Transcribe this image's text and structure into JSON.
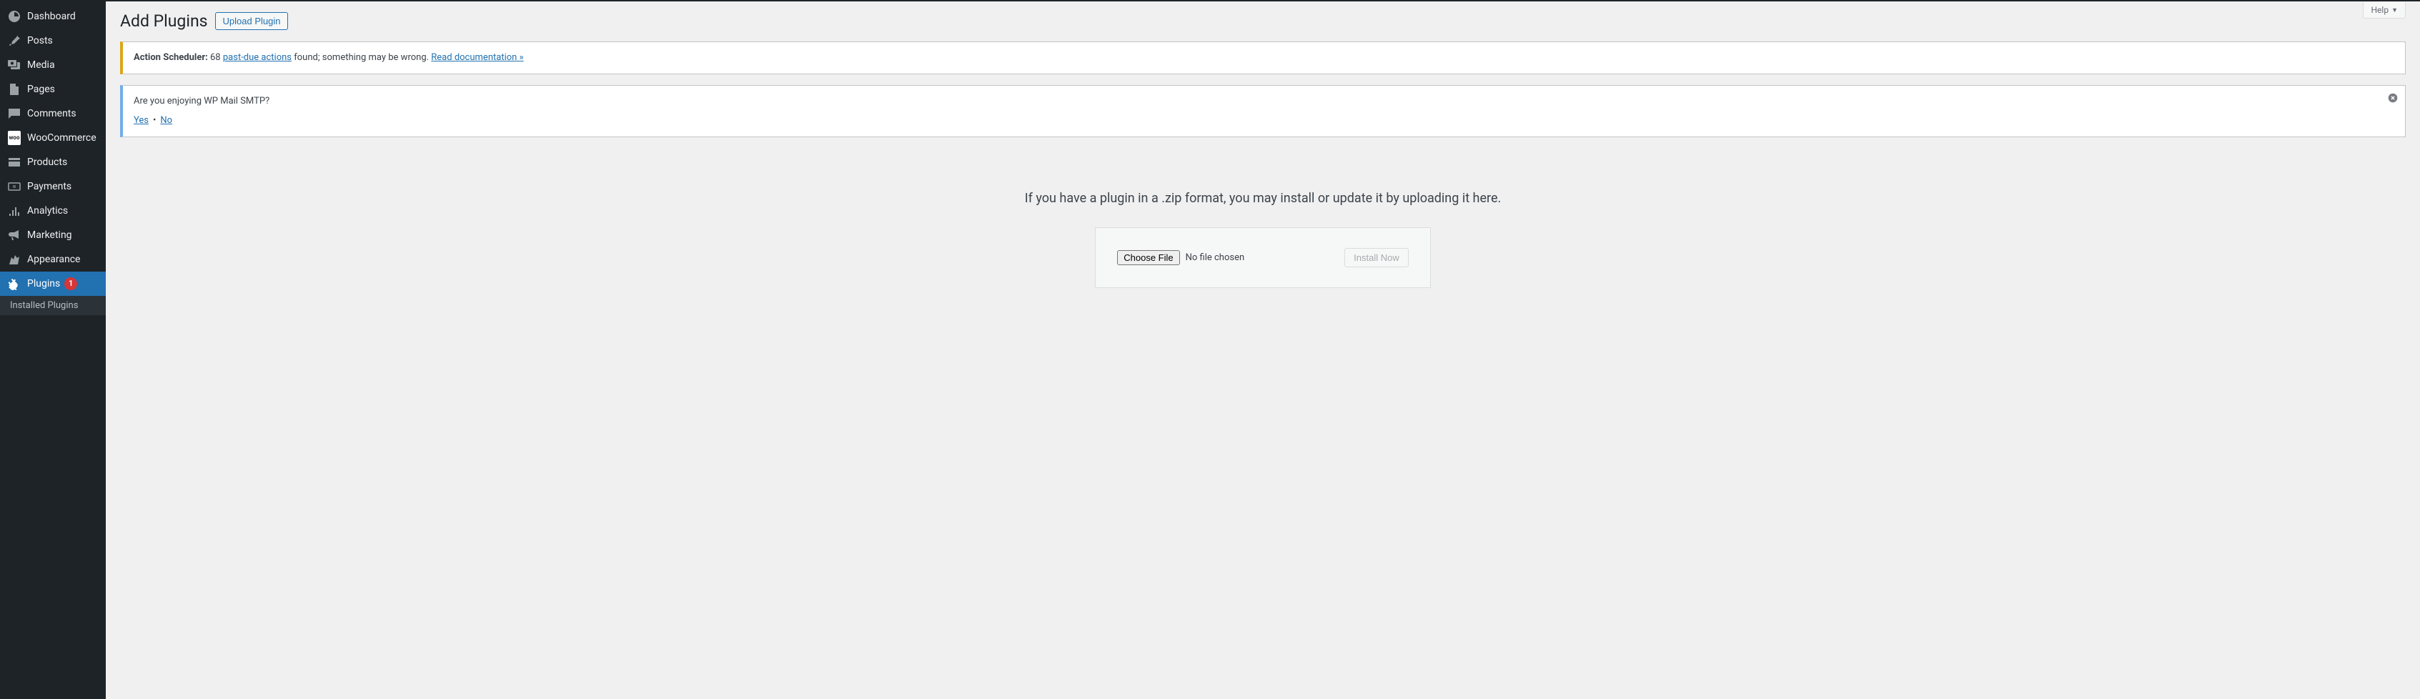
{
  "sidebar": {
    "items": [
      {
        "label": "Dashboard"
      },
      {
        "label": "Posts"
      },
      {
        "label": "Media"
      },
      {
        "label": "Pages"
      },
      {
        "label": "Comments"
      },
      {
        "label": "WooCommerce"
      },
      {
        "label": "Products"
      },
      {
        "label": "Payments"
      },
      {
        "label": "Analytics"
      },
      {
        "label": "Marketing"
      },
      {
        "label": "Appearance"
      },
      {
        "label": "Plugins",
        "badge": "1"
      }
    ],
    "submenu": {
      "installed": "Installed Plugins"
    }
  },
  "help_label": "Help",
  "page": {
    "title": "Add Plugins",
    "upload_btn": "Upload Plugin"
  },
  "notice_as": {
    "strong": "Action Scheduler:",
    "count": "68",
    "link1": "past-due actions",
    "mid": " found; something may be wrong. ",
    "link2": "Read documentation »"
  },
  "notice_smtp": {
    "question": "Are you enjoying WP Mail SMTP?",
    "yes": "Yes",
    "no": "No"
  },
  "upload": {
    "message": "If you have a plugin in a .zip format, you may install or update it by uploading it here.",
    "choose_file": "Choose File",
    "no_file": "No file chosen",
    "install_now": "Install Now"
  }
}
